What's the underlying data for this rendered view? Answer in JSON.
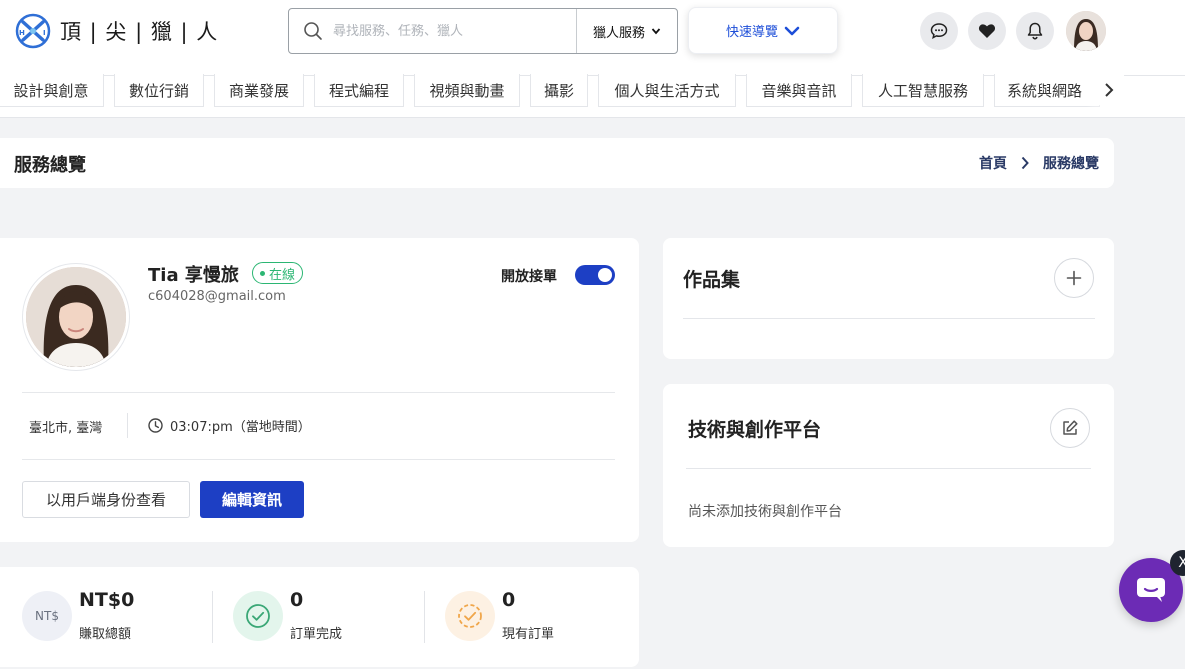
{
  "header": {
    "logo_text": "頂 | 尖 | 獵 | 人",
    "search_placeholder": "尋找服務、任務、獵人",
    "search_scope": "獵人服務",
    "quick_nav_label": "快速導覽",
    "icons": [
      "chat-icon",
      "heart-icon",
      "bell-icon"
    ]
  },
  "categories": [
    "設計與創意",
    "數位行銷",
    "商業發展",
    "程式編程",
    "視頻與動畫",
    "攝影",
    "個人與生活方式",
    "音樂與音訊",
    "人工智慧服務",
    "系統與網路"
  ],
  "page": {
    "title": "服務總覽",
    "breadcrumb_home": "首頁",
    "breadcrumb_current": "服務總覽"
  },
  "profile": {
    "name": "Tia 享慢旅",
    "status": "在線",
    "email": "c604028@gmail.com",
    "accept_orders_label": "開放接單",
    "accept_orders_on": true,
    "location": "臺北市, 臺灣",
    "local_time": "03:07:pm（當地時間）",
    "view_as_client_label": "以用戶端身份查看",
    "edit_label": "編輯資訊"
  },
  "stats": [
    {
      "icon_text": "NT$",
      "value": "NT$0",
      "label": "賺取總額"
    },
    {
      "icon": "check-circle-icon",
      "value": "0",
      "label": "訂單完成"
    },
    {
      "icon": "clock-circle-icon",
      "value": "0",
      "label": "現有訂單"
    }
  ],
  "portfolio": {
    "title": "作品集"
  },
  "platforms": {
    "title": "技術與創作平台",
    "empty_text": "尚未添加技術與創作平台"
  },
  "chat": {
    "close_glyph": "X"
  },
  "colors": {
    "primary": "#1d3fc4",
    "online_green": "#2bb673",
    "chat_purple": "#6c2bb5",
    "breadcrumb": "#2a3a66"
  }
}
